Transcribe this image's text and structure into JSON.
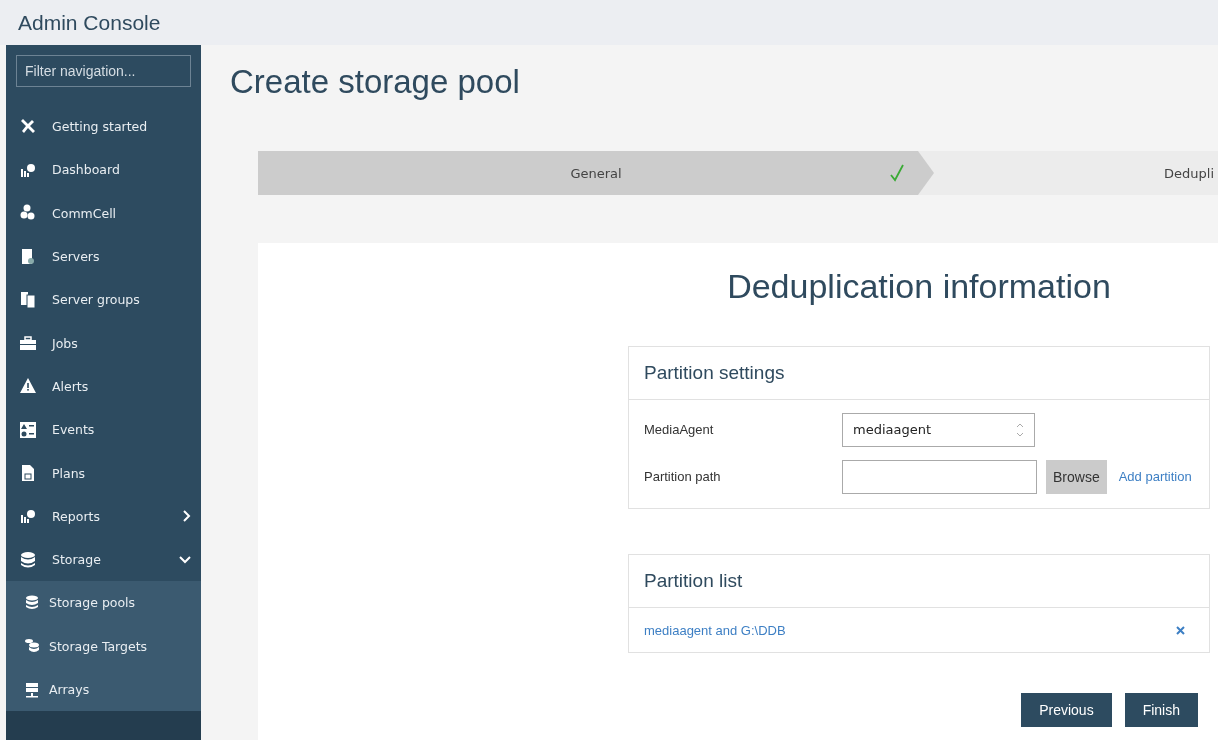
{
  "header": {
    "title": "Admin Console"
  },
  "sidebar": {
    "filter": {
      "placeholder": "Filter navigation..."
    },
    "items": [
      {
        "label": "Getting started"
      },
      {
        "label": "Dashboard"
      },
      {
        "label": "CommCell"
      },
      {
        "label": "Servers"
      },
      {
        "label": "Server groups"
      },
      {
        "label": "Jobs"
      },
      {
        "label": "Alerts"
      },
      {
        "label": "Events"
      },
      {
        "label": "Plans"
      },
      {
        "label": "Reports",
        "expanded": false
      },
      {
        "label": "Storage",
        "expanded": true,
        "children": [
          {
            "label": "Storage pools"
          },
          {
            "label": "Storage Targets"
          },
          {
            "label": "Arrays"
          }
        ]
      }
    ]
  },
  "page": {
    "title": "Create storage pool"
  },
  "wizard": {
    "steps": [
      {
        "label": "General",
        "completed": true
      },
      {
        "label": "Dedupli",
        "completed": false
      }
    ]
  },
  "section": {
    "title": "Deduplication information"
  },
  "partition_settings": {
    "title": "Partition settings",
    "fields": [
      {
        "kind": "select",
        "label": "MediaAgent",
        "value": "mediaagent"
      },
      {
        "kind": "path",
        "label": "Partition path",
        "button": "Browse",
        "link": "Add partition"
      }
    ]
  },
  "partition_list": {
    "title": "Partition list",
    "items": [
      {
        "label": "mediaagent and G:\\DDB"
      }
    ]
  },
  "buttons": [
    {
      "label": "Previous"
    },
    {
      "label": "Finish"
    }
  ]
}
